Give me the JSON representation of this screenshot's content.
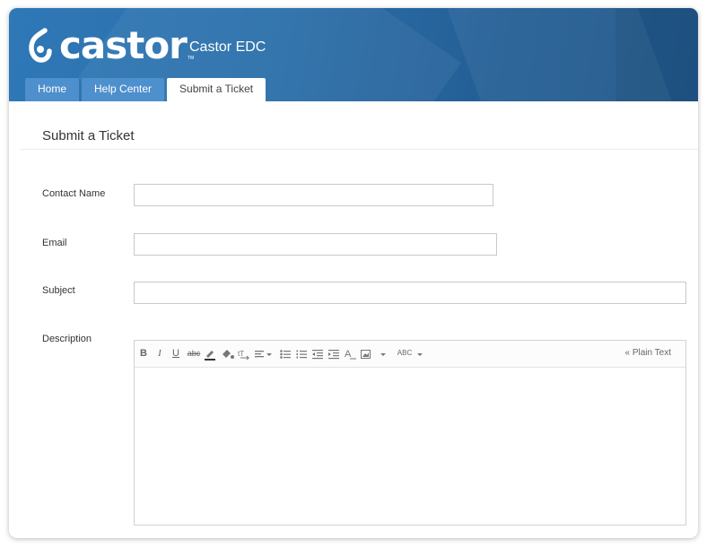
{
  "header": {
    "brand": "castor",
    "trademark": "TM",
    "app_title": "Castor EDC"
  },
  "tabs": [
    {
      "label": "Home",
      "active": false
    },
    {
      "label": "Help Center",
      "active": false
    },
    {
      "label": "Submit a Ticket",
      "active": true
    }
  ],
  "form": {
    "title": "Submit a Ticket",
    "contact_name": {
      "label": "Contact Name",
      "value": ""
    },
    "email": {
      "label": "Email",
      "value": ""
    },
    "subject": {
      "label": "Subject",
      "value": ""
    },
    "description": {
      "label": "Description",
      "value": ""
    }
  },
  "editor": {
    "toolbar": {
      "bold": "B",
      "italic": "I",
      "underline": "U",
      "strikethrough": "abc",
      "spellcheck": "ABC",
      "plain_text": "« Plain Text"
    }
  },
  "colors": {
    "header_blue": "#2a6ea9",
    "tab_blue": "#4e8fcd"
  }
}
